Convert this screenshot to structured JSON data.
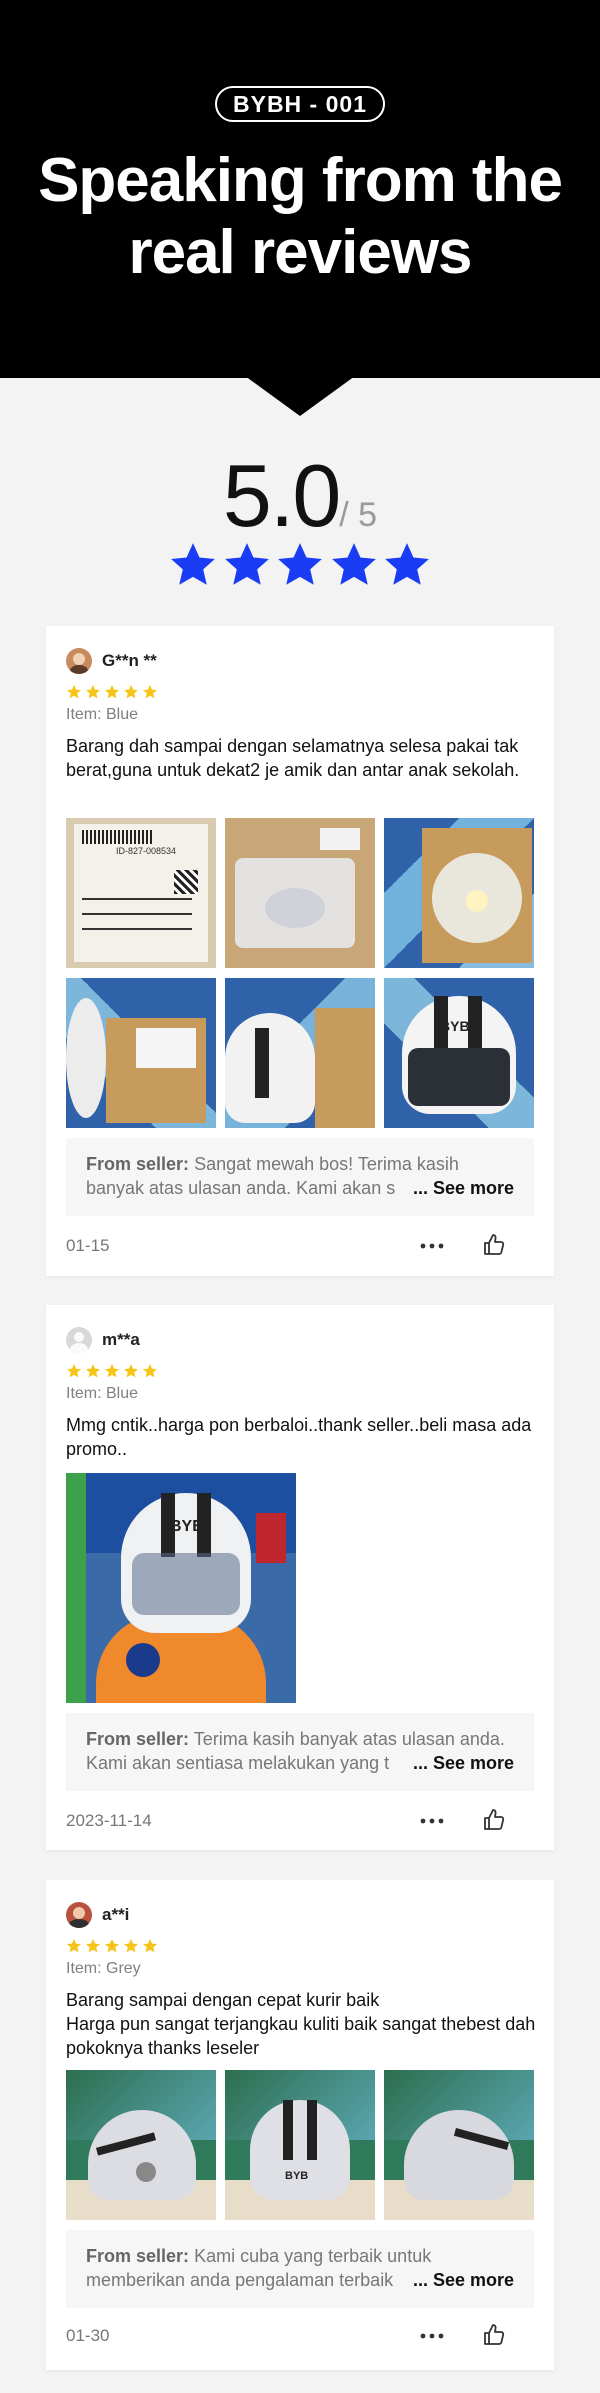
{
  "hero": {
    "badge": "BYBH - 001",
    "title_line1": "Speaking from the",
    "title_line2": "real reviews"
  },
  "rating": {
    "score": "5.0",
    "out_of": "/ 5",
    "stars": 5,
    "star_color": "#1a3cf5"
  },
  "reviews": [
    {
      "username": "G**n **",
      "stars": 5,
      "item": "Item: Blue",
      "text": "Barang dah sampai dengan selamatnya selesa pakai tak berat,guna untuk dekat2 je amik dan antar anak sekolah.",
      "seller_label": "From seller:",
      "seller_text": "Sangat mewah bos! Terima kasih banyak atas ulasan anda. Kami akan s",
      "see_more": "... See more",
      "date": "01-15"
    },
    {
      "username": "m**a",
      "stars": 5,
      "item": "Item: Blue",
      "text": "Mmg cntik..harga pon berbaloi..thank seller..beli masa ada promo..",
      "seller_label": "From seller:",
      "seller_text": "Terima kasih banyak atas ulasan anda. Kami akan sentiasa melakukan yang t",
      "see_more": "... See more",
      "date": "2023-11-14"
    },
    {
      "username": "a**i",
      "stars": 5,
      "item": "Item: Grey",
      "text": "Barang sampai dengan cepat kurir baik\nHarga pun sangat terjangkau kuliti baik sangat thebest dah pokoknya thanks leseler",
      "seller_label": "From seller:",
      "seller_text": "Kami cuba yang terbaik untuk memberikan anda pengalaman terbaik",
      "see_more": "... See more",
      "date": "01-30"
    }
  ],
  "photo_labels": {
    "shipping_code": "ID-827-008534",
    "helmet_brand": "BYB"
  },
  "colors": {
    "hero_bg": "#000000",
    "star_small": "#f5c518",
    "page_bg": "#f3f3f4"
  }
}
